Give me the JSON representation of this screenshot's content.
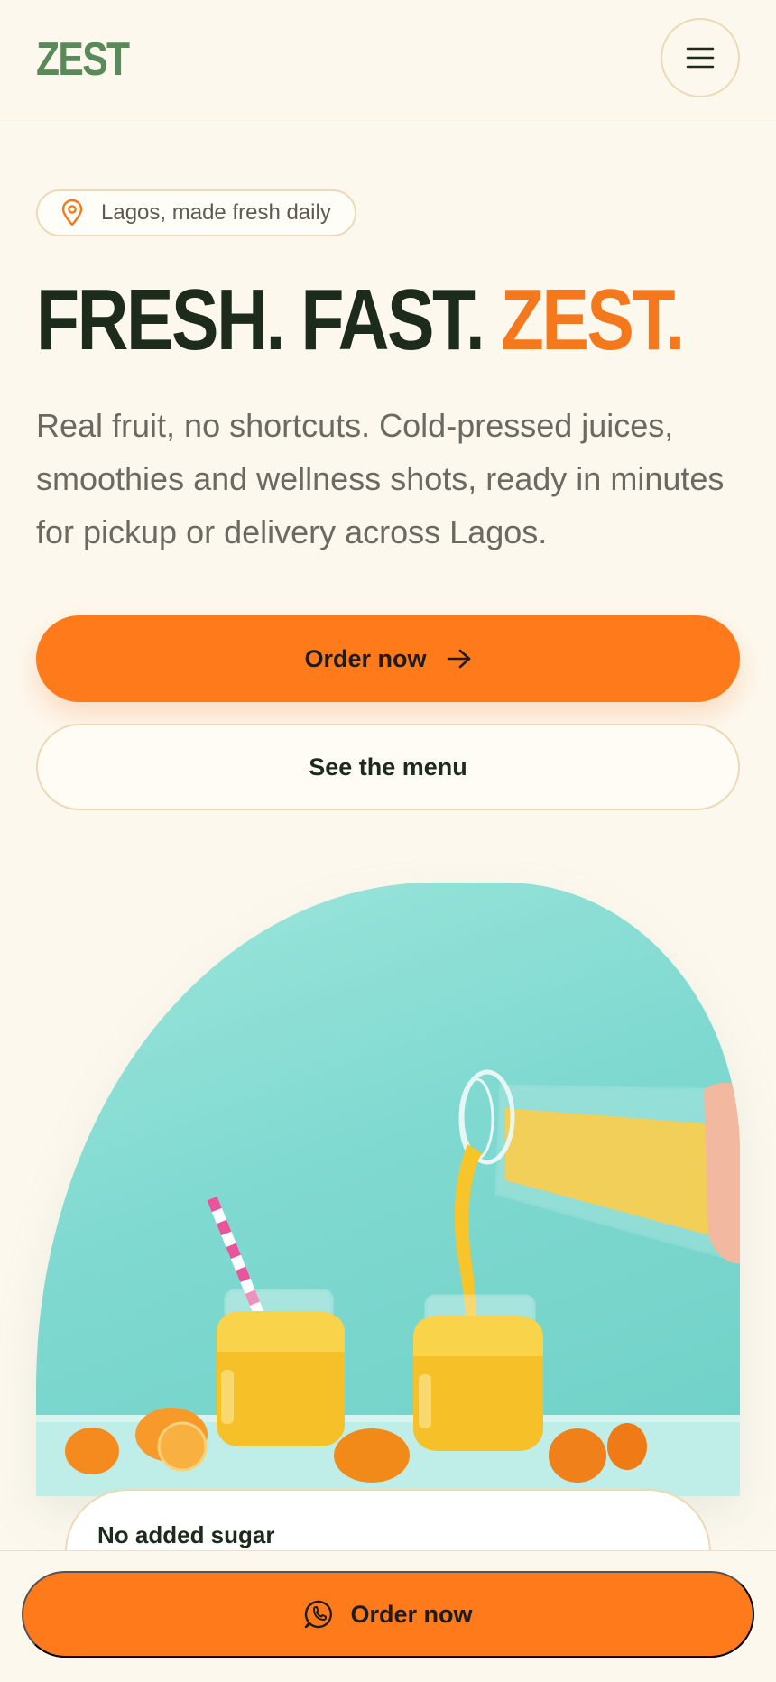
{
  "header": {
    "logo": "ZEST",
    "menu_icon": "hamburger-menu-icon"
  },
  "location": {
    "icon": "map-pin-icon",
    "text": "Lagos, made fresh daily"
  },
  "hero": {
    "headline_part1": "FRESH. FAST. ",
    "headline_accent": "ZEST.",
    "lead": "Real fruit, no shortcuts. Cold-pressed juices, smoothies and wellness shots, ready in minutes for pickup or delivery across Lagos.",
    "primary_cta": "Order now",
    "primary_cta_icon": "arrow-right-icon",
    "secondary_cta": "See the menu",
    "image_alt": "Orange juice being poured into glass jars"
  },
  "feature_card": {
    "title": "No added sugar"
  },
  "sticky_bar": {
    "cta": "Order now",
    "cta_icon": "whatsapp-phone-icon"
  },
  "colors": {
    "background": "#fdf8ee",
    "accent": "#ff7a1a",
    "logo_green": "#5a8a5a",
    "text_dark": "#1c2b1c",
    "border": "#ecd9b6"
  }
}
